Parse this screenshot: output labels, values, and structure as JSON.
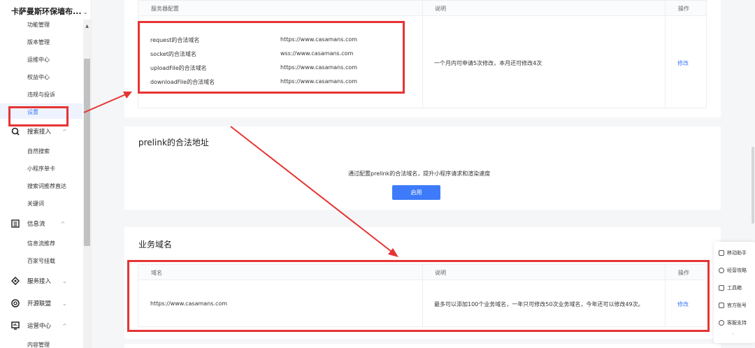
{
  "sidebar": {
    "brand": "卡萨曼斯环保墙布...",
    "brand_chevron": "⌄",
    "items_top": [
      {
        "label": "功能管理"
      },
      {
        "label": "版本管理"
      },
      {
        "label": "运维中心"
      },
      {
        "label": "权益中心"
      },
      {
        "label": "违规与投诉"
      },
      {
        "label": "设置"
      }
    ],
    "groups": [
      {
        "label": "搜索接入",
        "icon": "search-icon",
        "chevron": "^"
      },
      {
        "label": "信息流",
        "icon": "feed-icon",
        "chevron": "^"
      },
      {
        "label": "服务接入",
        "icon": "service-icon",
        "chevron": "⌄"
      },
      {
        "label": "开源联盟",
        "icon": "alliance-icon",
        "chevron": "⌄"
      },
      {
        "label": "运营中心",
        "icon": "operations-icon",
        "chevron": "^"
      }
    ],
    "search_sub": [
      "自然搜索",
      "小程序单卡",
      "搜索词推荐直达",
      "关键词"
    ],
    "feed_sub": [
      "信息流推荐",
      "百家号挂载"
    ],
    "ops_sub": [
      "内容管理"
    ]
  },
  "server_config": {
    "headers": {
      "col1": "服务器配置",
      "col2": "说明",
      "col3": "操作"
    },
    "rows": [
      {
        "label": "request的合法域名",
        "value": "https://www.casamans.com"
      },
      {
        "label": "socket的合法域名",
        "value": "wss://www.casamans.com"
      },
      {
        "label": "uploadFile的合法域名",
        "value": "https://www.casamans.com"
      },
      {
        "label": "downloadFile的合法域名",
        "value": "https://www.casamans.com"
      }
    ],
    "note": "一个月内可申请5次修改，本月还可修改4次",
    "action": "修改"
  },
  "prelink": {
    "title": "prelink的合法地址",
    "desc": "通过配置prelink的合法域名，提升小程序请求和渲染速度",
    "button": "启用"
  },
  "business_domain": {
    "title": "业务域名",
    "headers": {
      "col1": "域名",
      "col2": "说明",
      "col3": "操作"
    },
    "domain": "https://www.casamans.com",
    "note": "最多可以添加100个业务域名，一年只可修改50次业务域名，今年还可以修改49次。",
    "action": "修改"
  },
  "float_bar": {
    "items": [
      {
        "label": "移动助手",
        "icon": "mobile-icon"
      },
      {
        "label": "经营攻略",
        "icon": "strategy-icon"
      },
      {
        "label": "工具箱",
        "icon": "toolbox-icon"
      },
      {
        "label": "官方账号",
        "icon": "official-account-icon"
      },
      {
        "label": "客服支持",
        "icon": "support-icon"
      }
    ],
    "more": "›"
  },
  "colors": {
    "accent": "#3d7bfa",
    "annotation_red": "#e63434"
  }
}
